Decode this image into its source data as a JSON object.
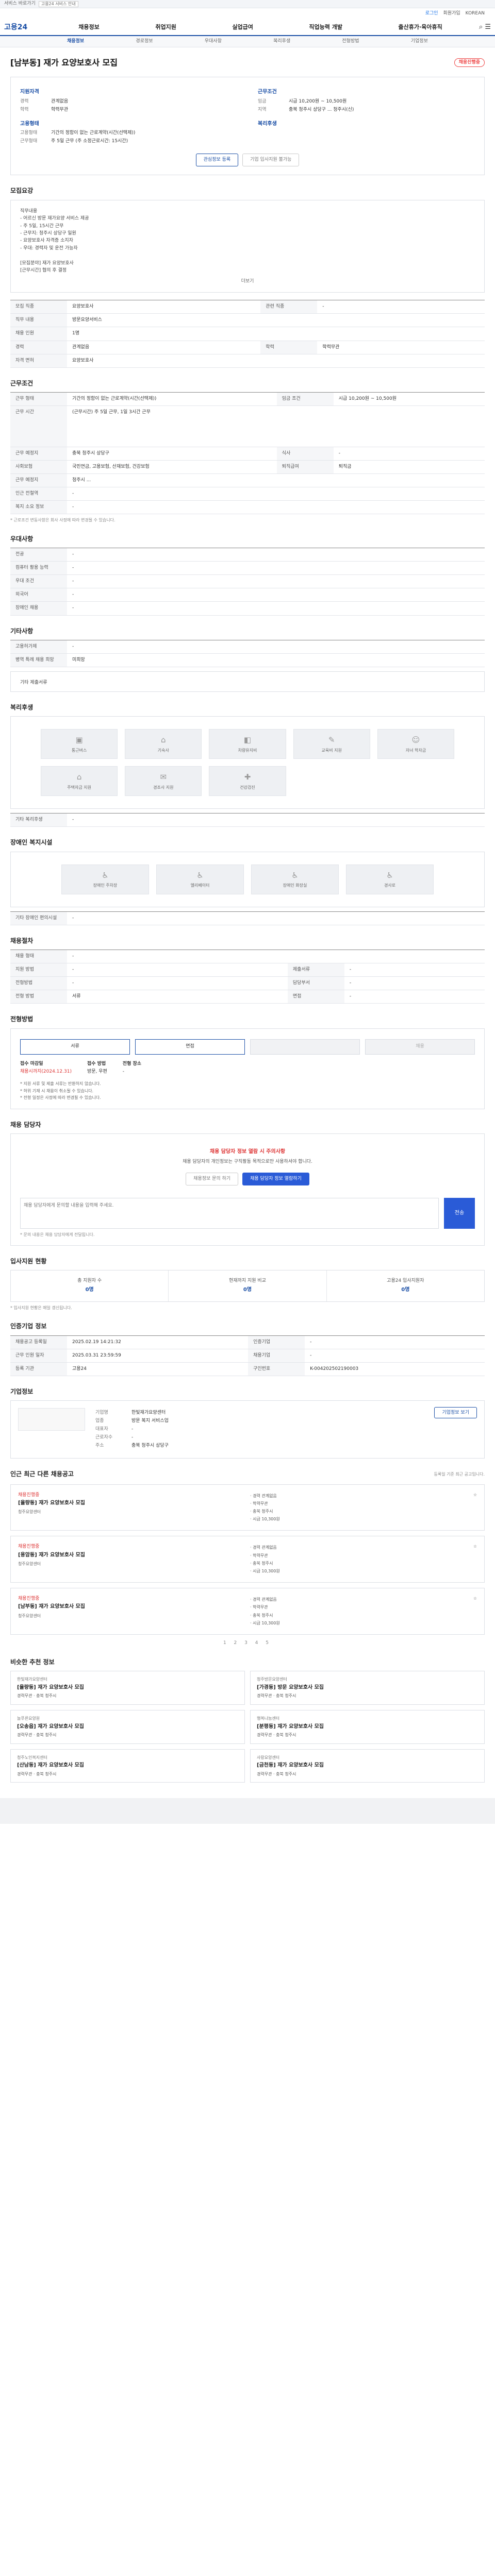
{
  "topstrip": {
    "text": "서비스 바로가기",
    "select": "고용24 서비스 안내"
  },
  "userbar": {
    "login": "로그인",
    "join": "회원가입",
    "lang": "KOREAN"
  },
  "gnb": {
    "logo": "고용24",
    "menu": [
      "채용정보",
      "취업지원",
      "실업급여",
      "직업능력 개발",
      "출산휴가·육아휴직"
    ]
  },
  "lnb": [
    "채용정보",
    "경로정보",
    "우대사항",
    "복리후생",
    "전형방법",
    "기업정보"
  ],
  "header": {
    "title": "[남부동] 재가 요양보호사 모집",
    "status": "채용진행중"
  },
  "summary": {
    "left_title": "지원자격",
    "left": [
      [
        "경력",
        "관계없음"
      ],
      [
        "학력",
        "학력무관"
      ]
    ],
    "left2_title": "고용형태",
    "left2": [
      [
        "고용형태",
        "기간의 정함이 없는 근로계약(시간(선택제))"
      ],
      [
        "근무형태",
        "주 5일 근무 (주 소정근로시간: 15시간)"
      ]
    ],
    "right_title": "근무조건",
    "right": [
      [
        "임금",
        "시급 10,200원 ~ 10,500원"
      ],
      [
        "지역",
        "충북 청주시 상당구 ... 청주시(신)"
      ]
    ],
    "right2_title": "복리후생",
    "btn1": "관심정보 등록",
    "btn2": "기업 입사지원 불가능"
  },
  "detail": {
    "title": "모집요강",
    "body": [
      "직무내용",
      "- 어르신 방문 재가요양 서비스 제공",
      "- 주 5일, 15시간 근무",
      "- 근무지: 청주시 상당구 일원",
      "- 요양보호사 자격증 소지자",
      "- 우대: 경력자 및 운전 가능자",
      "",
      "[모집분야] 재가 요양보호사",
      "[근무시간] 협의 후 결정"
    ],
    "more": "더보기"
  },
  "recruit_table": [
    [
      "모집 직종",
      "요양보호사",
      "관련 직종",
      "-"
    ],
    [
      "직무 내용",
      "방문요양서비스",
      "",
      "",
      ""
    ],
    [
      "채용 인원",
      "1명",
      "",
      ""
    ],
    [
      "경력",
      "관계없음",
      "학력",
      "학력무관"
    ],
    [
      "자격 면허",
      "요양보호사",
      "",
      ""
    ]
  ],
  "work": {
    "title": "근무조건",
    "rows": [
      [
        "근무 형태",
        "기간의 정함이 없는 근로계약(시간(선택제))",
        "임금 조건",
        "시급 10,200원 ~ 10,500원"
      ],
      [
        "근무 시간",
        "(근무시간) 주 5일 근무, 1일 3시간 근무"
      ],
      [
        "근무 예정지",
        "충북 청주시 상당구",
        "식사",
        "-"
      ],
      [
        "사회보험",
        "국민연금, 고용보험, 산재보험, 건강보험",
        "퇴직급여",
        "퇴직금"
      ],
      [
        "근무 예정지",
        "청주시 ...",
        "",
        ""
      ],
      [
        "인근 전철역",
        "-"
      ],
      [
        "복지 소요 정보",
        "-"
      ]
    ],
    "note": "* 근로조건 변동사항은 회사 사정에 따라 변경될 수 있습니다."
  },
  "prefer": {
    "title": "우대사항",
    "rows": [
      [
        "전공",
        "-"
      ],
      [
        "컴퓨터 활용 능력",
        "-"
      ],
      [
        "우대 조건",
        "-"
      ],
      [
        "외국어",
        "-"
      ],
      [
        "장애인 채용",
        "-"
      ]
    ]
  },
  "etc": {
    "title": "기타사항",
    "rows": [
      [
        "고용허가제",
        "-"
      ],
      [
        "병역 특례 채용 희망",
        "미희망"
      ]
    ],
    "sub": "기타 제출서류"
  },
  "welfare": {
    "title": "복리후생",
    "items": [
      "통근버스",
      "기숙사",
      "차량유지비",
      "교육비 지원",
      "자녀 학자금",
      "주택자금 지원",
      "경조사 지원",
      "건강검진"
    ],
    "etc_label": "기타 복리후생",
    "etc": "-"
  },
  "disabled": {
    "title": "장애인 복지시설",
    "items": [
      "장애인 주차장",
      "엘리베이터",
      "장애인 화장실",
      "경사로"
    ],
    "etc_label": "기타 장애인 편의시설",
    "etc": "-"
  },
  "worker": {
    "title": "채용절차",
    "rows": [
      [
        "채용 형태",
        "-"
      ],
      [
        "지원 방법",
        "-",
        "제출서류",
        "-"
      ],
      [
        "전형방법",
        "-",
        "담당부서",
        "-"
      ],
      [
        "전형 방법",
        "서류",
        "면접",
        "-"
      ]
    ]
  },
  "process": {
    "title": "전형방법",
    "steps": [
      "서류",
      "면접",
      "",
      "채용"
    ],
    "info": [
      [
        "접수 마감일",
        "채용시까지(2024.12.31)"
      ],
      [
        "접수 방법",
        "방문, 우편"
      ],
      [
        "전형 장소",
        "-"
      ]
    ],
    "bullets": [
      "* 지원 서류 및 제출 서류는 반환하지 않습니다.",
      "* 허위 기재 시 채용이 취소될 수 있습니다.",
      "* 전형 일정은 사정에 따라 변경될 수 있습니다."
    ]
  },
  "qa": {
    "title": "채용 담당자",
    "alert": "채용 담당자 정보 열람 시 주의사항",
    "text": "채용 담당자의 개인정보는 구직활동 목적으로만 사용하셔야 합니다.",
    "btn1": "채용정보 문의 하기",
    "btn2": "채용 담당자 정보 열람하기",
    "ph": "채용 담당자에게 문의할 내용을 입력해 주세요.",
    "send": "전송",
    "hint": "* 문의 내용은 채용 담당자에게 전달됩니다."
  },
  "stats": {
    "title": "입사지원 현황",
    "items": [
      [
        "총 지원자 수",
        "0명"
      ],
      [
        "현재까지 지원 비교",
        "0명"
      ],
      [
        "고용24 입사지원자",
        "0명"
      ]
    ]
  },
  "stats_note": "* 입사지원 현황은 매일 갱신됩니다.",
  "manage": {
    "title": "인증기업 정보",
    "rows": [
      [
        "채용공고 등록일",
        "2025.02.19 14:21:32",
        "인증기업",
        "-"
      ],
      [
        "근무 인원 일자",
        "2025.03.31 23:59:59",
        "채용기업",
        "-"
      ],
      [
        "등록 기관",
        "고용24",
        "구인번호",
        "K-004202502190003"
      ]
    ]
  },
  "company": {
    "title": "기업정보",
    "kv": [
      [
        "기업명",
        "한빛재가요양센터"
      ],
      [
        "업종",
        "방문 복지 서비스업"
      ],
      [
        "대표자",
        "-"
      ],
      [
        "근로자수",
        "-"
      ],
      [
        "주소",
        "충북 청주시 상당구"
      ]
    ],
    "btn": "기업정보 보기"
  },
  "other": {
    "title": "인근 최근 다른 채용공고",
    "sub": "등록일 기준 최근 공고입니다.",
    "jobs": [
      {
        "n": "채용진행중",
        "t": "[율량동] 재가 요양보호사 모집",
        "s": "청주요양센터",
        "m": [
          "경력 관계없음",
          "학력무관",
          "충북 청주시",
          "시급 10,300원"
        ]
      },
      {
        "n": "채용진행중",
        "t": "[용암동] 재가 요양보호사 모집",
        "s": "청주요양센터",
        "m": [
          "경력 관계없음",
          "학력무관",
          "충북 청주시",
          "시급 10,300원"
        ]
      },
      {
        "n": "채용진행중",
        "t": "[남부동] 재가 요양보호사 모집",
        "s": "청주요양센터",
        "m": [
          "경력 관계없음",
          "학력무관",
          "충북 청주시",
          "시급 10,300원"
        ]
      }
    ],
    "pager": "1 2 3 4 5"
  },
  "similar": {
    "title": "비슷한 추천 정보",
    "items": [
      {
        "co": "한빛재가요양센터",
        "t": "[율량동] 재가 요양보호사 모집",
        "s": "경력무관 · 충북 청주시"
      },
      {
        "co": "청주방문요양센터",
        "t": "[가경동] 방문 요양보호사 모집",
        "s": "경력무관 · 충북 청주시"
      },
      {
        "co": "늘푸른요양원",
        "t": "[오송읍] 재가 요양보호사 모집",
        "s": "경력무관 · 충북 청주시"
      },
      {
        "co": "행복나눔센터",
        "t": "[분평동] 재가 요양보호사 모집",
        "s": "경력무관 · 충북 청주시"
      },
      {
        "co": "청주노인복지센터",
        "t": "[산남동] 재가 요양보호사 모집",
        "s": "경력무관 · 충북 청주시"
      },
      {
        "co": "사랑요양센터",
        "t": "[금천동] 재가 요양보호사 모집",
        "s": "경력무관 · 충북 청주시"
      }
    ]
  }
}
